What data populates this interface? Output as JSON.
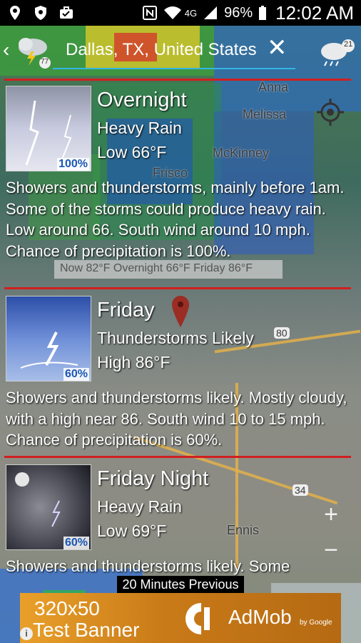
{
  "status_bar": {
    "battery": "96%",
    "network": "4G",
    "time": "12:02 AM",
    "icons": [
      "location-icon",
      "shield-icon",
      "briefcase-icon",
      "nfc-icon",
      "wifi-icon",
      "signal-icon",
      "battery-icon"
    ]
  },
  "search": {
    "location": "Dallas, TX, United States",
    "left_icon_badge": "77",
    "right_icon_badge": "21"
  },
  "map": {
    "labels": [
      "Anna",
      "Melissa",
      "McKinney",
      "Frisco",
      "Ennis"
    ],
    "highway_shields": [
      "80",
      "34"
    ],
    "tooltip": "Now 82°F Overnight  66°F Friday  86°F",
    "time_strip": "20 Minutes Previous"
  },
  "forecast": [
    {
      "period": "Overnight",
      "condition": "Heavy Rain",
      "temp": "Low 66°F",
      "precip": "100%",
      "description": "Showers and thunderstorms, mainly before 1am. Some of the storms could produce heavy rain.  Low around 66. South wind around 10 mph.  Chance of precipitation is 100%."
    },
    {
      "period": "Friday",
      "condition": "Thunderstorms Likely",
      "temp": "High 86°F",
      "precip": "60%",
      "description": "Showers and thunderstorms likely.  Mostly cloudy, with a high near 86. South wind 10 to 15 mph.  Chance of precipitation is 60%."
    },
    {
      "period": "Friday Night",
      "condition": "Heavy Rain",
      "temp": "Low 69°F",
      "precip": "60%",
      "description": "Showers and thunderstorms likely. Some"
    }
  ],
  "ad": {
    "line1": "320x50",
    "line2": "Test Banner",
    "brand": "AdMob",
    "by": "by Google",
    "info": "i"
  },
  "colors": {
    "divider": "#d11f1f",
    "underline": "#33b5e5",
    "precip_label": "#1a57b5"
  }
}
